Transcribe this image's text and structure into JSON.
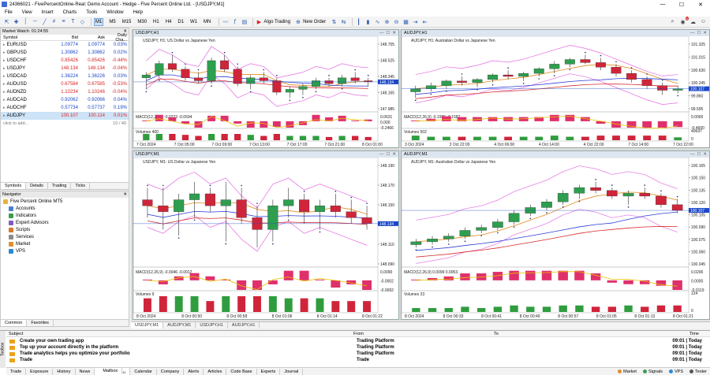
{
  "window": {
    "title": "24366021 - FivePercentOnline-Real: Demo Account - Hedge - Five Percent Online Ltd. - [USDJPY,M1]"
  },
  "menu": [
    "File",
    "View",
    "Insert",
    "Charts",
    "Tools",
    "Window",
    "Help"
  ],
  "toolbar": {
    "timeframes": [
      "M1",
      "M5",
      "M15",
      "M30",
      "H1",
      "H4",
      "D1",
      "W1",
      "MN"
    ],
    "active_timeframe": "M1",
    "algo_label": "Algo Trading",
    "new_order_label": "New Order",
    "notif_count": "1"
  },
  "market_watch": {
    "title": "Market Watch: 01:24:55",
    "columns": {
      "symbol": "Symbol",
      "bid": "Bid",
      "ask": "Ask",
      "change": "Daily Cha..."
    },
    "rows": [
      {
        "symbol": "EURUSD",
        "bid": "1.09774",
        "ask": "1.09774",
        "change": "0.03%",
        "color": "blue"
      },
      {
        "symbol": "GBPUSD",
        "bid": "1.30862",
        "ask": "1.30862",
        "change": "0.02%",
        "color": "blue"
      },
      {
        "symbol": "USDCHF",
        "bid": "0.85426",
        "ask": "0.85426",
        "change": "-0.44%",
        "color": "red"
      },
      {
        "symbol": "USDJPY",
        "bid": "148.134",
        "ask": "148.134",
        "change": "-0.04%",
        "color": "red"
      },
      {
        "symbol": "USDCAD",
        "bid": "1.36224",
        "ask": "1.36226",
        "change": "0.03%",
        "color": "blue"
      },
      {
        "symbol": "AUDUSD",
        "bid": "0.67584",
        "ask": "0.67585",
        "change": "-0.53%",
        "color": "red"
      },
      {
        "symbol": "AUDNZD",
        "bid": "1.10234",
        "ask": "1.10246",
        "change": "-0.04%",
        "color": "red"
      },
      {
        "symbol": "AUDCAD",
        "bid": "0.92062",
        "ask": "0.92066",
        "change": "0.04%",
        "color": "blue"
      },
      {
        "symbol": "AUDCHF",
        "bid": "0.57734",
        "ask": "0.57737",
        "change": "0.19%",
        "color": "blue"
      },
      {
        "symbol": "AUDJPY",
        "bid": "100.107",
        "ask": "100.114",
        "change": "0.01%",
        "color": "red"
      }
    ],
    "add_label": "click to add...",
    "count": "10 / 40",
    "tabs": [
      "Symbols",
      "Details",
      "Trading",
      "Ticks"
    ]
  },
  "navigator": {
    "title": "Navigator",
    "root": "Five Percent Online MT5",
    "items": [
      "Accounts",
      "Indicators",
      "Expert Advisors",
      "Scripts",
      "Services",
      "Market",
      "VPS"
    ],
    "tabs": [
      "Common",
      "Favorites"
    ]
  },
  "charts": [
    {
      "title": "USDJPY,H1",
      "info": "USDJPY, H1: US Dollar vs Japanese Yen",
      "price_labels": [
        "148.705",
        "148.525",
        "148.345",
        "148.165",
        "147.985"
      ],
      "price_tag": "148.134",
      "macd_label": "MACD(12,26,9) -0.0223 -0.0594",
      "macd_scale": [
        "0.0631",
        "0.000",
        "-0.2466"
      ],
      "volume_label": "Volumes 400",
      "time_labels": [
        "7 Oct 2024",
        "7 Oct 05:00",
        "7 Oct 09:00",
        "7 Oct 13:00",
        "7 Oct 17:00",
        "7 Oct 21:00",
        "8 Oct 01:00"
      ],
      "candles": [
        [
          148.2,
          148.3,
          148.0,
          148.25
        ],
        [
          148.25,
          148.5,
          148.2,
          148.45
        ],
        [
          148.45,
          148.6,
          148.3,
          148.35
        ],
        [
          148.35,
          148.4,
          148.15,
          148.2
        ],
        [
          148.2,
          148.3,
          148.1,
          148.15
        ],
        [
          148.15,
          148.55,
          148.1,
          148.5
        ],
        [
          148.5,
          148.6,
          148.3,
          148.35
        ],
        [
          148.35,
          148.4,
          148.05,
          148.1
        ],
        [
          148.1,
          148.25,
          148.0,
          148.2
        ],
        [
          148.2,
          148.3,
          148.1,
          148.15
        ],
        [
          148.15,
          148.2,
          147.9,
          147.95
        ],
        [
          147.95,
          148.05,
          147.85,
          148.0
        ],
        [
          148.0,
          148.1,
          147.9,
          148.05
        ],
        [
          148.05,
          148.2,
          148.0,
          148.15
        ],
        [
          148.15,
          148.2,
          148.05,
          148.1
        ],
        [
          148.1,
          148.25,
          148.05,
          148.2
        ],
        [
          148.2,
          148.3,
          148.1,
          148.15
        ],
        [
          148.15,
          148.2,
          148.05,
          148.13
        ]
      ]
    },
    {
      "title": "AUDJPY,H1",
      "info": "AUDJPY, H1: Australian Dollar vs Japanese Yen",
      "price_labels": [
        "101.325",
        "101.015",
        "100.630",
        "100.245",
        "99.860",
        "99.595"
      ],
      "price_tag": "100.107",
      "macd_label": "MACD(12,26,9) -0.1985 -0.1587",
      "macd_scale": [
        "0.0000",
        "-0.4600"
      ],
      "volume_label": "Volumes 502",
      "volume_scale": [
        "40697",
        "0"
      ],
      "time_labels": [
        "3 Oct 2024",
        "3 Oct 22:00",
        "4 Oct 06:00",
        "4 Oct 14:00",
        "4 Oct 22:00",
        "7 Oct 14:00",
        "7 Oct 22:00"
      ],
      "candles": [
        [
          100.0,
          100.2,
          99.8,
          100.1
        ],
        [
          100.1,
          100.3,
          100.0,
          100.2
        ],
        [
          100.2,
          100.4,
          100.1,
          100.35
        ],
        [
          100.35,
          100.5,
          100.2,
          100.3
        ],
        [
          100.3,
          100.45,
          100.15,
          100.4
        ],
        [
          100.4,
          100.6,
          100.3,
          100.55
        ],
        [
          100.55,
          100.7,
          100.4,
          100.5
        ],
        [
          100.5,
          100.65,
          100.35,
          100.6
        ],
        [
          100.6,
          100.8,
          100.5,
          100.75
        ],
        [
          100.75,
          101.0,
          100.6,
          100.9
        ],
        [
          100.9,
          101.1,
          100.8,
          101.05
        ],
        [
          101.05,
          101.2,
          100.9,
          100.95
        ],
        [
          100.95,
          101.1,
          100.7,
          100.8
        ],
        [
          100.8,
          100.9,
          100.5,
          100.6
        ],
        [
          100.6,
          100.7,
          100.3,
          100.4
        ],
        [
          100.4,
          100.5,
          100.1,
          100.2
        ],
        [
          100.2,
          100.3,
          99.9,
          100.05
        ],
        [
          100.05,
          100.2,
          99.95,
          100.1
        ]
      ]
    },
    {
      "title": "USDJPY,M1",
      "info": "USDJPY, M1: US Dollar vs Japanese Yen",
      "price_labels": [
        "148.190",
        "148.170",
        "148.150",
        "148.130",
        "148.110",
        "148.090"
      ],
      "price_tag": "148.134",
      "macd_label": "MACD(12,26,9) -0.0046 -0.0012",
      "macd_scale": [
        "0.0090",
        "-0.0002",
        "-0.0092"
      ],
      "volume_label": "Volumes 9",
      "time_labels": [
        "8 Oct 2024",
        "8 Oct 00:50",
        "8 Oct 00:58",
        "8 Oct 01:06",
        "8 Oct 01:14",
        "8 Oct 01:22"
      ],
      "candles": [
        [
          148.17,
          148.19,
          148.14,
          148.16
        ],
        [
          148.16,
          148.19,
          148.12,
          148.15
        ],
        [
          148.15,
          148.18,
          148.11,
          148.17
        ],
        [
          148.17,
          148.2,
          148.14,
          148.18
        ],
        [
          148.18,
          148.19,
          148.15,
          148.16
        ],
        [
          148.16,
          148.2,
          148.1,
          148.17
        ],
        [
          148.17,
          148.19,
          148.13,
          148.14
        ],
        [
          148.14,
          148.16,
          148.09,
          148.12
        ],
        [
          148.12,
          148.17,
          148.1,
          148.16
        ],
        [
          148.16,
          148.19,
          148.14,
          148.17
        ],
        [
          148.17,
          148.18,
          148.13,
          148.15
        ],
        [
          148.15,
          148.17,
          148.12,
          148.16
        ],
        [
          148.16,
          148.18,
          148.14,
          148.15
        ],
        [
          148.15,
          148.17,
          148.13,
          148.14
        ],
        [
          148.14,
          148.16,
          148.12,
          148.13
        ]
      ]
    },
    {
      "title": "AUDJPY,M1",
      "info": "AUDJPY, M1: Australian Dollar vs Japanese Yen",
      "price_labels": [
        "100.165",
        "100.150",
        "100.135",
        "100.120",
        "100.105",
        "100.090",
        "100.075",
        "100.060",
        "100.045"
      ],
      "price_tag": "100.107",
      "macd_label": "MACD(12,26,9) 0.0099 0.0053",
      "macd_scale": [
        "0.0206",
        "0.0000",
        "-0.0119"
      ],
      "volume_label": "Volumes 23",
      "volume_scale": [
        "124",
        "0"
      ],
      "time_labels": [
        "8 Oct 2024",
        "8 Oct 00:33",
        "8 Oct 00:41",
        "8 Oct 00:49",
        "8 Oct 00:57",
        "8 Oct 01:05",
        "8 Oct 01:13",
        "8 Oct 01:21"
      ],
      "candles": [
        [
          100.05,
          100.06,
          100.045,
          100.055
        ],
        [
          100.055,
          100.065,
          100.05,
          100.06
        ],
        [
          100.06,
          100.07,
          100.055,
          100.065
        ],
        [
          100.065,
          100.08,
          100.06,
          100.075
        ],
        [
          100.075,
          100.085,
          100.07,
          100.08
        ],
        [
          100.08,
          100.095,
          100.075,
          100.09
        ],
        [
          100.09,
          100.11,
          100.085,
          100.105
        ],
        [
          100.105,
          100.12,
          100.1,
          100.115
        ],
        [
          100.115,
          100.13,
          100.11,
          100.125
        ],
        [
          100.125,
          100.145,
          100.12,
          100.14
        ],
        [
          100.14,
          100.155,
          100.13,
          100.15
        ],
        [
          100.15,
          100.16,
          100.14,
          100.145
        ],
        [
          100.145,
          100.15,
          100.13,
          100.135
        ],
        [
          100.135,
          100.145,
          100.12,
          100.14
        ],
        [
          100.14,
          100.15,
          100.13,
          100.135
        ],
        [
          100.135,
          100.14,
          100.115,
          100.12
        ],
        [
          100.12,
          100.13,
          100.105,
          100.11
        ]
      ]
    }
  ],
  "chart_tabs": [
    "USDJPY,M1",
    "AUDJPY,M1",
    "USDJPY,H1",
    "AUDJPY,H1"
  ],
  "toolbox": {
    "side_label": "Toolbox",
    "columns": {
      "subject": "Subject",
      "from": "From",
      "to": "To",
      "time": "Time"
    },
    "messages": [
      {
        "subject": "Create your own trading app",
        "from": "Trading Platform",
        "time": "09:01 | Today"
      },
      {
        "subject": "Top up your account directly in the platform",
        "from": "Trading Platform",
        "time": "09:01 | Today"
      },
      {
        "subject": "Trade analytics helps you optimize your portfolio",
        "from": "Trading Platform",
        "time": "09:01 | Today"
      },
      {
        "subject": "Trade",
        "from": "Trade",
        "time": "09:01 | Today"
      }
    ],
    "tabs": [
      "Trade",
      "Exposure",
      "History",
      "News",
      "Mailbox",
      "Calendar",
      "Company",
      "Alerts",
      "Articles",
      "Code Base",
      "Experts",
      "Journal"
    ],
    "mailbox_badge": "11",
    "status": {
      "market": "Market",
      "signals": "Signals",
      "vps": "VPS",
      "tester": "Tester"
    }
  },
  "colors": {
    "bull": "#2e9e4f",
    "bear": "#d0243a",
    "bb": "#e36be0",
    "ma_fast": "#e08a1e",
    "ma_slow": "#d62b2b",
    "ma_blue": "#2b3bd6",
    "sar": "#1b2160",
    "macd_hist": "#e0306c",
    "signal": "#e6c400",
    "vol": "#2f9d3e",
    "tag": "#1a47c8"
  }
}
